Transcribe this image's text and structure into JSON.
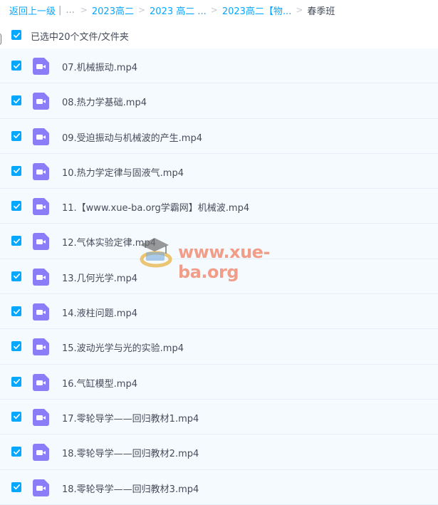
{
  "breadcrumb": {
    "back": "返回上一级",
    "divider": "|",
    "ellipsis": "...",
    "items": [
      "2023高二",
      "2023 高二 ...",
      "2023高二【物..."
    ],
    "current": "春季班"
  },
  "selection": {
    "text": "已选中20个文件/文件夹"
  },
  "files": [
    {
      "name": "07.机械振动.mp4"
    },
    {
      "name": "08.热力学基础.mp4"
    },
    {
      "name": "09.受迫振动与机械波的产生.mp4"
    },
    {
      "name": "10.热力学定律与固液气.mp4"
    },
    {
      "name": "11.【www.xue-ba.org学霸网】机械波.mp4"
    },
    {
      "name": "12.气体实验定律.mp4"
    },
    {
      "name": "13.几何光学.mp4"
    },
    {
      "name": "14.液柱问题.mp4"
    },
    {
      "name": "15.波动光学与光的实验.mp4"
    },
    {
      "name": "16.气缸模型.mp4"
    },
    {
      "name": "17.零轮导学——回归教材1.mp4"
    },
    {
      "name": "18.零轮导学——回归教材2.mp4"
    },
    {
      "name": "18.零轮导学——回归教材3.mp4"
    }
  ],
  "watermark": {
    "text": "www.xue-ba.org"
  },
  "colors": {
    "accent": "#06a7ff",
    "video_icon": "#8b7df7",
    "row_bg": "#f5faff"
  }
}
